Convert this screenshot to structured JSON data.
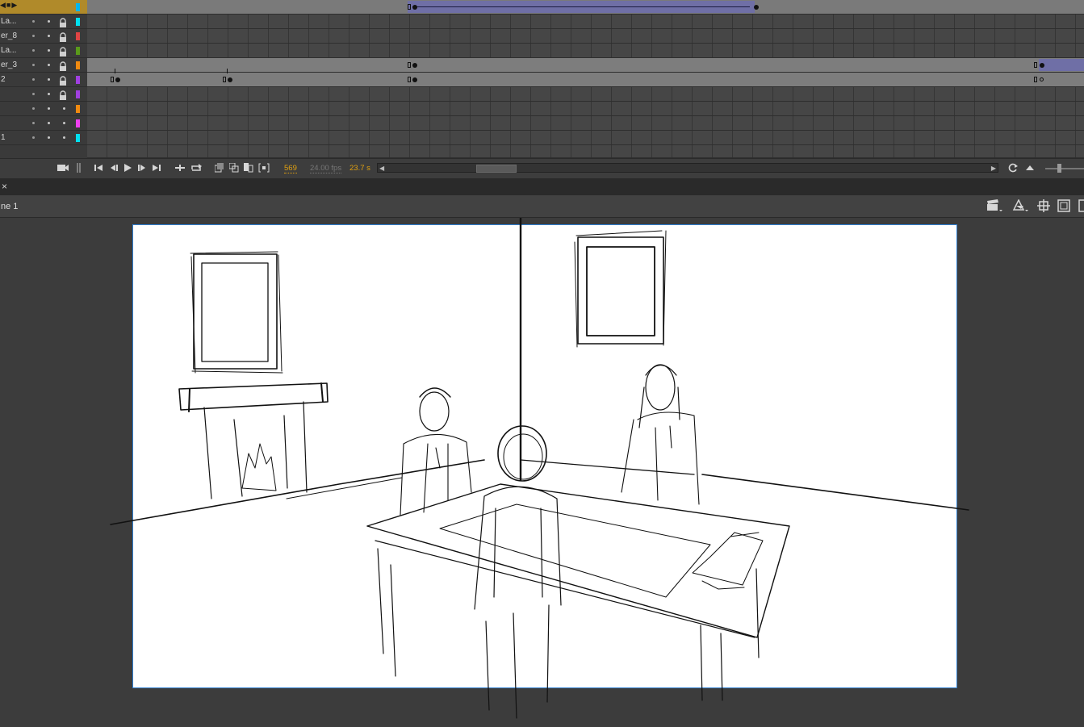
{
  "timeline": {
    "layers": [
      {
        "name": "",
        "color": "#00b7f0",
        "active": true
      },
      {
        "name": " La...",
        "color": "#00e0f0"
      },
      {
        "name": "er_8",
        "color": "#e04444"
      },
      {
        "name": " La...",
        "color": "#5a9a1a"
      },
      {
        "name": "er_3",
        "color": "#f08a10"
      },
      {
        "name": "2",
        "color": "#a040e0"
      },
      {
        "name": "",
        "color": "#a040e0"
      },
      {
        "name": "",
        "color": "#f08a10"
      },
      {
        "name": "",
        "color": "#f040f0"
      },
      {
        "name": "1",
        "color": "#00e0f0"
      }
    ],
    "waveform_color": "#e0602a",
    "playhead_color": "#c21818",
    "tween_color": "#6f6fa6"
  },
  "controls": {
    "frame": "569",
    "fps": "24.00 fps",
    "time": "23.7 s",
    "icons": [
      "camera-icon",
      "go-first-icon",
      "step-back-icon",
      "play-icon",
      "step-forward-icon",
      "go-last-icon",
      "loop-icon",
      "onion-skin-icon",
      "edit-multiple-frames-icon"
    ]
  },
  "stage": {
    "scene_label": "ne 1",
    "close_glyph": "×",
    "toolbar_icons": [
      "clapperboard-icon",
      "symbol-icon",
      "snap-icon",
      "clip-icon"
    ]
  }
}
